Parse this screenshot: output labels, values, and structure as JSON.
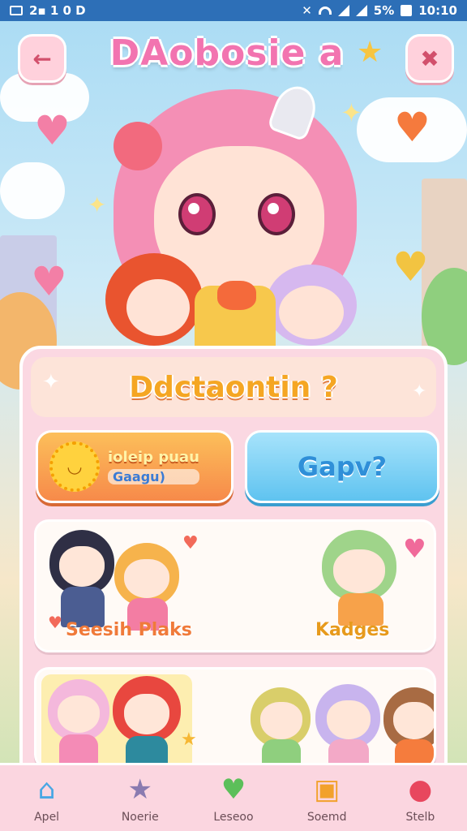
{
  "status_bar": {
    "left_text": "2▪ 1 0  D",
    "battery_percent": "5%",
    "time": "10:10"
  },
  "header": {
    "title": "DAobosie a",
    "back_icon": "back-arrow-icon",
    "menu_icon": "menu-icon"
  },
  "panel": {
    "question_title": "Ddctaontin ?",
    "orange_button": {
      "title": "ioleip puau",
      "subtitle": "Gaagu)"
    },
    "blue_button": {
      "label": "Gapv?"
    },
    "cards": [
      {
        "left_label": "Seesih Plaks",
        "right_label": "Kadges"
      }
    ]
  },
  "bottom_nav": {
    "items": [
      {
        "label": "Apel",
        "icon": "house-icon"
      },
      {
        "label": "Noerie",
        "icon": "star-icon"
      },
      {
        "label": "Leseoo",
        "icon": "heart-icon"
      },
      {
        "label": "Soemd",
        "icon": "tv-icon"
      },
      {
        "label": "Stelb",
        "icon": "candy-icon"
      }
    ]
  },
  "colors": {
    "status_bar": "#2d6fb7",
    "title_pink": "#f274b0",
    "panel_pink": "#fbd8e2",
    "orange": "#f78a4a",
    "blue": "#5fc3f0"
  }
}
